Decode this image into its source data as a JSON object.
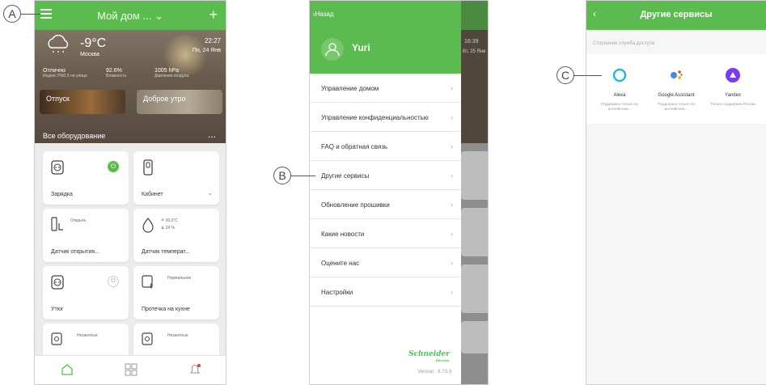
{
  "callouts": {
    "a": "A",
    "b": "B",
    "c": "C"
  },
  "screen1": {
    "header": {
      "title": "Мой дом ...",
      "dropdown_caret": "⌄",
      "add_symbol": "+"
    },
    "weather": {
      "temperature": "-9°C",
      "city": "Москва",
      "time": "22:27",
      "date": "Пн, 24 Янв",
      "stats": [
        {
          "value": "Отлично",
          "label": "Индекс PM2.5 на улице"
        },
        {
          "value": "92.6%",
          "label": "Влажность"
        },
        {
          "value": "1005 hPa",
          "label": "Давление воздуха"
        }
      ]
    },
    "scenes": [
      "Отпуск",
      "Доброе утро"
    ],
    "all_devices_label": "Все оборудование",
    "more_dots": "...",
    "devices": [
      {
        "name": "Зарядка",
        "state": "",
        "icon": "socket-icon"
      },
      {
        "name": "Кабинет",
        "state": "",
        "icon": "switch-icon"
      },
      {
        "name": "Датчик открытия...",
        "state": "Открыть",
        "icon": "door-sensor-icon"
      },
      {
        "name": "Датчик температ...",
        "state": "≜ 36.0°C",
        "state2": "⇊ 24 %",
        "icon": "temperature-sensor-icon"
      },
      {
        "name": "Утюг",
        "state": "",
        "icon": "socket-icon"
      },
      {
        "name": "Протечка на кухне",
        "state": "Нормальное",
        "icon": "leak-sensor-icon"
      },
      {
        "name": "",
        "state": "Незанятые",
        "icon": "motion-sensor-icon"
      },
      {
        "name": "",
        "state": "Незанятые",
        "icon": "motion-sensor-icon"
      }
    ],
    "colors": {
      "brand_green": "#5cbb4e"
    }
  },
  "screen2": {
    "back_label": "Назад",
    "user_name": "Yuri",
    "menu": [
      "Управление домом",
      "Управление конфиденциальностью",
      "FAQ и обратная связь",
      "Другие сервисы",
      "Обновление прошивки",
      "Какие новости",
      "Оцените нас",
      "Настройки"
    ],
    "background_hints": {
      "time": "16:39",
      "date": "Вт, 25 Янв"
    },
    "brand": "Schneider",
    "brand_sub": "Electric",
    "version": "Version : 8.73.0"
  },
  "screen3": {
    "title": "Другие сервисы",
    "subtitle": "Сторонние служба доступа",
    "services": [
      {
        "name": "Alexa",
        "desc": "Поддержка только на английском...",
        "icon": "alexa-icon"
      },
      {
        "name": "Google Assistant",
        "desc": "Поддержка только на английском...",
        "icon": "google-assistant-icon"
      },
      {
        "name": "Yandex",
        "desc": "Только поддержка России",
        "icon": "yandex-icon"
      }
    ]
  }
}
